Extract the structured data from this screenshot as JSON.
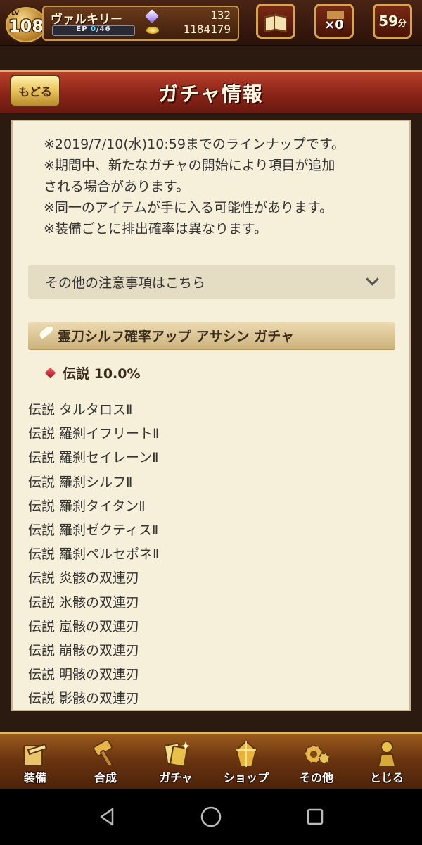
{
  "status": {
    "level_label": "LV",
    "level": "108",
    "player_name": "ヴァルキリー",
    "ep_label": "EP",
    "ep_current": "0",
    "ep_max": "/46",
    "ep_fraction": 0,
    "gems": "132",
    "gold": "1184179",
    "ticket_count": "×0",
    "stamina_value": "59",
    "stamina_unit": "分"
  },
  "header": {
    "back_label": "もどる",
    "title": "ガチャ情報"
  },
  "notes": [
    "※2019/7/10(水)10:59までのラインナップです。",
    "※期間中、新たなガチャの開始により項目が追加",
    "される場合があります。",
    "※同一のアイテムが手に入る可能性があります。",
    "※装備ごとに排出確率は異なります。"
  ],
  "accordion": {
    "label": "その他の注意事項はこちら"
  },
  "gacha": {
    "title": "霊刀シルフ確率アップ アサシン ガチャ",
    "rarity_label": "伝説 10.0%",
    "items": [
      "伝説 タルタロスⅡ",
      "伝説 羅刹イフリートⅡ",
      "伝説 羅刹セイレーンⅡ",
      "伝説 羅刹シルフⅡ",
      "伝説 羅刹タイタンⅡ",
      "伝説 羅刹ゼクティスⅡ",
      "伝説 羅刹ペルセポネⅡ",
      "伝説 炎骸の双連刃",
      "伝説 氷骸の双連刃",
      "伝説 嵐骸の双連刃",
      "伝説 崩骸の双連刃",
      "伝説 明骸の双連刃",
      "伝説 影骸の双連刃"
    ]
  },
  "nav": [
    {
      "label": "装備",
      "icon": "equipment-icon"
    },
    {
      "label": "合成",
      "icon": "hammer-icon"
    },
    {
      "label": "ガチャ",
      "icon": "gacha-cards-icon"
    },
    {
      "label": "ショップ",
      "icon": "crystal-shop-icon"
    },
    {
      "label": "その他",
      "icon": "gear-icon"
    },
    {
      "label": "とじる",
      "icon": "close-figure-icon"
    }
  ],
  "colors": {
    "banner": "#8a2418",
    "panel": "#f6efd9",
    "gold_trim": "#d7a54a"
  }
}
